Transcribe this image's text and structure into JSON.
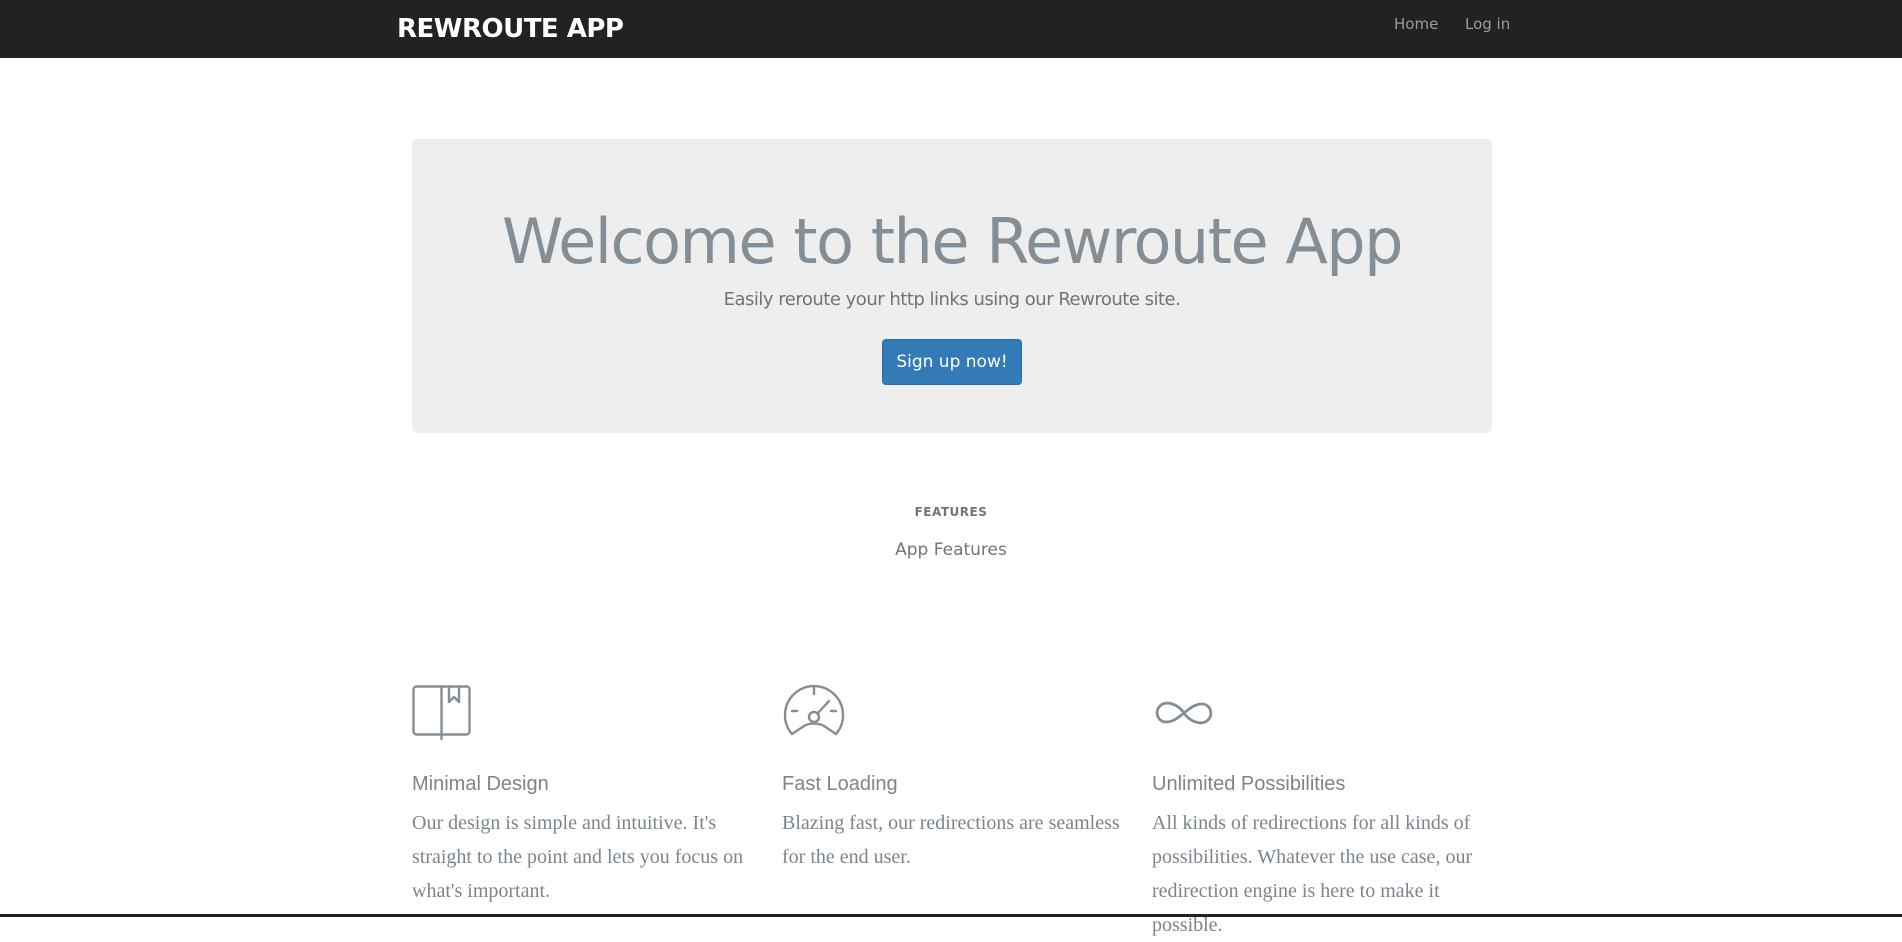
{
  "navbar": {
    "brand": "REWROUTE APP",
    "links": [
      "Home",
      "Log in"
    ]
  },
  "jumbotron": {
    "title": "Welcome to the Rewroute App",
    "subtitle": "Easily reroute your http links using our Rewroute site.",
    "cta_label": "Sign up now!"
  },
  "features": {
    "kicker": "FEATURES",
    "title": "App Features",
    "items": [
      {
        "icon": "book-icon",
        "heading": "Minimal Design",
        "text": "Our design is simple and intuitive. It's straight to the point and lets you focus on what's important."
      },
      {
        "icon": "speedometer-icon",
        "heading": "Fast Loading",
        "text": "Blazing fast, our redirections are seamless for the end user."
      },
      {
        "icon": "infinity-icon",
        "heading": "Unlimited Possibilities",
        "text": "All kinds of redirections for all kinds of possibilities. Whatever the use case, our redirection engine is here to make it possible."
      }
    ]
  },
  "colors": {
    "navbar_bg": "#222222",
    "jumbotron_bg": "#eeeeee",
    "primary": "#337ab7",
    "muted_text": "#848e96"
  }
}
